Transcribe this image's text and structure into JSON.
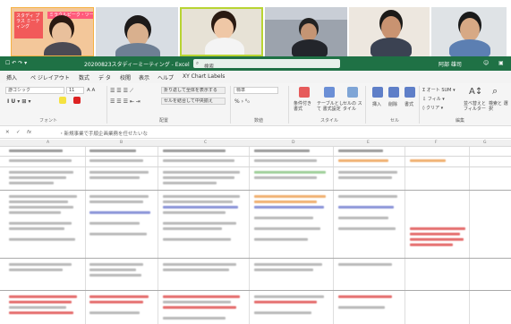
{
  "video": {
    "sign_text": "スタディ プラス ミーティング",
    "banner_text": "ミラクルピーク・ツーリア・アズ"
  },
  "excel": {
    "quick_access": "☐ ↶ ↷ ▾",
    "file_title": "20200823スタディーミーティング - Excel",
    "search_placeholder": "検索",
    "user_name": "阿部 雄司",
    "menu": [
      "挿入",
      "ペ ジレイアウト",
      "数式",
      "デ タ",
      "校閲",
      "表示",
      "ヘルプ",
      "XY Chart Labels"
    ],
    "font_name": "游ゴシック",
    "font_size": "11",
    "wrap_text": "折り返して全体を表示する",
    "merge_center": "セルを結合して中央揃え",
    "number_format": "標準",
    "autosum": "オート SUM",
    "fill": "フィル",
    "clear": "クリア",
    "sort_filter": "並べ替えと フィルター",
    "find_select": "検索と 選択",
    "conditional_format": "条件付き 書式",
    "table_format": "テーブルとして 書式設定",
    "cell_styles": "セルの スタイル",
    "insert": "挿入",
    "delete": "削除",
    "format": "書式",
    "groups": [
      "フォント",
      "配置",
      "数値",
      "スタイル",
      "セル",
      "編集"
    ],
    "formula_text": "・新規事業で手順企画業務を任せたいな",
    "col_letters": [
      "A",
      "B",
      "C",
      "D",
      "E",
      "F",
      "G"
    ]
  }
}
